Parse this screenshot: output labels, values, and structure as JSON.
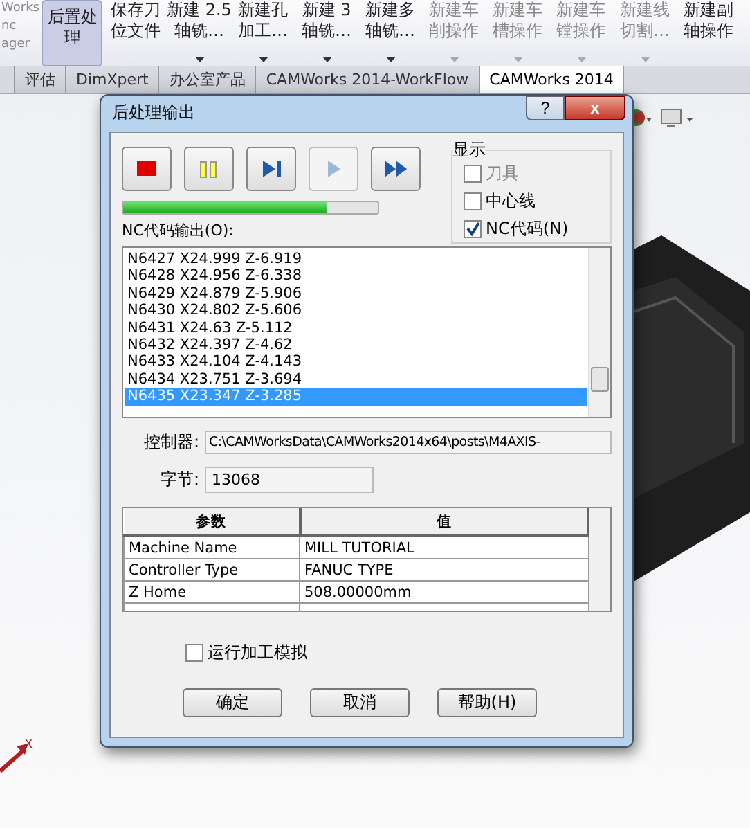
{
  "ribbon": {
    "items": [
      {
        "lines": [
          "Works",
          "nc",
          "ager"
        ],
        "selected": false,
        "disabled": true,
        "dropdown": false,
        "partial": true
      },
      {
        "lines": [
          "后置处",
          "理"
        ],
        "selected": true,
        "disabled": false,
        "dropdown": false,
        "partial": false
      },
      {
        "lines": [
          "保存刀",
          "位文件"
        ],
        "selected": false,
        "disabled": false,
        "dropdown": false,
        "partial": false
      },
      {
        "lines": [
          "新建 2.5",
          "轴铣…"
        ],
        "selected": false,
        "disabled": false,
        "dropdown": true,
        "partial": false
      },
      {
        "lines": [
          "新建孔",
          "加工…"
        ],
        "selected": false,
        "disabled": false,
        "dropdown": true,
        "partial": false
      },
      {
        "lines": [
          "新建 3",
          "轴铣…"
        ],
        "selected": false,
        "disabled": false,
        "dropdown": true,
        "partial": false
      },
      {
        "lines": [
          "新建多",
          "轴铣…"
        ],
        "selected": false,
        "disabled": false,
        "dropdown": true,
        "partial": false
      },
      {
        "lines": [
          "新建车",
          "削操作"
        ],
        "selected": false,
        "disabled": true,
        "dropdown": true,
        "partial": false
      },
      {
        "lines": [
          "新建车",
          "槽操作"
        ],
        "selected": false,
        "disabled": true,
        "dropdown": true,
        "partial": false
      },
      {
        "lines": [
          "新建车",
          "镗操作"
        ],
        "selected": false,
        "disabled": true,
        "dropdown": true,
        "partial": false
      },
      {
        "lines": [
          "新建线",
          "切割…"
        ],
        "selected": false,
        "disabled": true,
        "dropdown": true,
        "partial": false
      },
      {
        "lines": [
          "新建副",
          "轴操作"
        ],
        "selected": false,
        "disabled": false,
        "dropdown": false,
        "partial": false
      }
    ]
  },
  "tabs": [
    {
      "label": "评估",
      "selected": false
    },
    {
      "label": "DimXpert",
      "selected": false
    },
    {
      "label": "办公室产品",
      "selected": false
    },
    {
      "label": "CAMWorks 2014-WorkFlow",
      "selected": false
    },
    {
      "label": "CAMWorks 2014",
      "selected": true
    }
  ],
  "dialog": {
    "title": "后处理输出",
    "help": "?",
    "close": "x",
    "controls": [
      {
        "kind": "stop",
        "disabled": false
      },
      {
        "kind": "pause",
        "disabled": false
      },
      {
        "kind": "step",
        "disabled": false
      },
      {
        "kind": "play",
        "disabled": true
      },
      {
        "kind": "fast",
        "disabled": false
      }
    ],
    "progress": {
      "level": 0.8
    },
    "display_group": {
      "title": "显示",
      "options": [
        {
          "label": "刀具",
          "checked": false,
          "disabled": true
        },
        {
          "label": "中心线",
          "checked": false,
          "disabled": false
        },
        {
          "label": "NC代码(N)",
          "checked": true,
          "disabled": false
        }
      ]
    },
    "output_label": "NC代码输出(O):",
    "output_lines": [
      {
        "text": "N6427 X24.999 Z-6.919",
        "selected": false
      },
      {
        "text": "N6428 X24.956 Z-6.338",
        "selected": false
      },
      {
        "text": "N6429 X24.879 Z-5.906",
        "selected": false
      },
      {
        "text": "N6430 X24.802 Z-5.606",
        "selected": false
      },
      {
        "text": "N6431 X24.63 Z-5.112",
        "selected": false
      },
      {
        "text": "N6432 X24.397 Z-4.62",
        "selected": false
      },
      {
        "text": "N6433 X24.104 Z-4.143",
        "selected": false
      },
      {
        "text": "N6434 X23.751 Z-3.694",
        "selected": false
      },
      {
        "text": "N6435 X23.347 Z-3.285",
        "selected": true
      }
    ],
    "controller": {
      "label": "控制器:",
      "value": "C:\\CAMWorksData\\CAMWorks2014x64\\posts\\M4AXIS-"
    },
    "bytes": {
      "label": "字节:",
      "value": "13068"
    },
    "table": {
      "columns": [
        "参数",
        "值"
      ],
      "rows": [
        [
          "Machine Name",
          "MILL TUTORIAL"
        ],
        [
          "Controller Type",
          "FANUC TYPE"
        ],
        [
          "Z Home",
          "508.00000mm"
        ]
      ]
    },
    "simulate": {
      "label": "运行加工模拟",
      "checked": false
    },
    "buttons": [
      "确定",
      "取消",
      "帮助(H)"
    ]
  },
  "triad": {
    "axis_label": "X"
  }
}
